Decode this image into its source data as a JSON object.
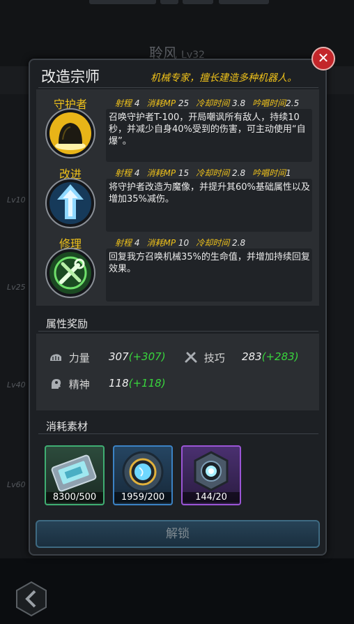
{
  "background": {
    "hero_name": "聆风",
    "hero_level": "Lv32",
    "level_markers": [
      "Lv10",
      "Lv25",
      "Lv40",
      "Lv60"
    ]
  },
  "dialog": {
    "title": "改造宗师",
    "subtitle": "机械专家，擅长建造多种机器人。",
    "close_icon": "close-icon",
    "skills": [
      {
        "name": "守护者",
        "icon": "dome-guardian-icon",
        "range_label": "射程",
        "range": "4",
        "mp_label": "消耗MP",
        "mp": "25",
        "cooldown_label": "冷却时间",
        "cooldown": "3.8",
        "chant_label": "吟唱时间",
        "chant": "2.5",
        "description": "召唤守护者T-100，开局嘲讽所有敌人，持续10秒，并减少自身40%受到的伤害，可主动使用“自爆”。"
      },
      {
        "name": "改进",
        "icon": "upgrade-arrow-icon",
        "range_label": "射程",
        "range": "4",
        "mp_label": "消耗MP",
        "mp": "15",
        "cooldown_label": "冷却时间",
        "cooldown": "2.8",
        "chant_label": "吟唱时间",
        "chant": "1",
        "description": "将守护者改造为魔像，并提升其60%基础属性以及增加35%减伤。"
      },
      {
        "name": "修理",
        "icon": "wrench-repair-icon",
        "range_label": "射程",
        "range": "4",
        "mp_label": "消耗MP",
        "mp": "10",
        "cooldown_label": "冷却时间",
        "cooldown": "2.8",
        "description": "回复我方召唤机械35%的生命值，并增加持续回复效果。"
      }
    ],
    "attributes_title": "属性奖励",
    "attributes": [
      {
        "label": "力量",
        "value": "307",
        "bonus": "(+307)",
        "icon": "strength-fist-icon"
      },
      {
        "label": "技巧",
        "value": "283",
        "bonus": "(+283)",
        "icon": "skill-tools-icon"
      },
      {
        "label": "精神",
        "value": "118",
        "bonus": "(+118)",
        "icon": "spirit-head-icon"
      }
    ],
    "materials_title": "消耗素材",
    "materials": [
      {
        "count": "8300/500",
        "icon": "chip-card-icon",
        "border": "#3fae72"
      },
      {
        "count": "1959/200",
        "icon": "mech-core-blue-icon",
        "border": "#3b82c4"
      },
      {
        "count": "144/20",
        "icon": "mech-core-purple-icon",
        "border": "#9b55d6"
      }
    ],
    "unlock_label": "解锁"
  }
}
